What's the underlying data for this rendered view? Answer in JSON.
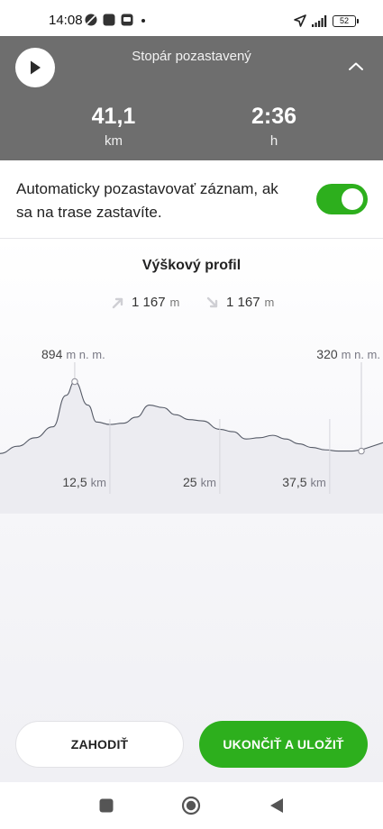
{
  "status_bar": {
    "time": "14:08",
    "battery": "52",
    "icons": [
      "no-disturb-icon",
      "app-icon",
      "ad-icon",
      "location-arrow-icon",
      "signal-icon",
      "battery-icon"
    ]
  },
  "tracker": {
    "title": "Stopár pozastavený",
    "distance": {
      "value": "41,1",
      "unit": "km"
    },
    "duration": {
      "value": "2:36",
      "unit": "h"
    },
    "state_color": "#6e6e6e"
  },
  "auto_pause": {
    "label": "Automaticky pozastavovať záznam, ak sa na trase zastavíte.",
    "enabled": true,
    "accent": "#2daf1d"
  },
  "elevation": {
    "title": "Výškový profil",
    "ascent": {
      "value": "1 167",
      "unit": "m"
    },
    "descent": {
      "value": "1 167",
      "unit": "m"
    },
    "max_label": {
      "value": "894",
      "unit": "m n. m."
    },
    "current_label": {
      "value": "320",
      "unit": "m n. m."
    },
    "ticks": [
      {
        "value": "12,5",
        "unit": "km"
      },
      {
        "value": "25",
        "unit": "km"
      },
      {
        "value": "37,5",
        "unit": "km"
      }
    ]
  },
  "chart_data": {
    "type": "area",
    "title": "Výškový profil",
    "x_unit": "km",
    "y_unit": "m n. m.",
    "x": [
      0,
      2,
      4,
      6,
      7.5,
      8.5,
      10,
      11,
      12.5,
      14,
      15.5,
      17,
      18.5,
      20,
      21.5,
      23,
      25,
      26.5,
      28,
      29.5,
      31,
      32.5,
      34,
      35.5,
      37,
      38.5,
      40,
      41.1
    ],
    "y": [
      300,
      360,
      430,
      520,
      780,
      894,
      700,
      560,
      540,
      550,
      600,
      700,
      680,
      620,
      580,
      570,
      500,
      480,
      420,
      430,
      450,
      420,
      380,
      350,
      330,
      320,
      320,
      330
    ],
    "x_ticks": [
      12.5,
      25,
      37.5
    ],
    "max_point": {
      "x": 8.5,
      "y": 894
    },
    "current_point": {
      "x": 41.1,
      "y": 320
    }
  },
  "actions": {
    "discard": "ZAHODIŤ",
    "save": "UKONČIŤ A ULOŽIŤ"
  },
  "nav": {
    "icons": [
      "recents-icon",
      "home-icon",
      "back-icon"
    ]
  }
}
